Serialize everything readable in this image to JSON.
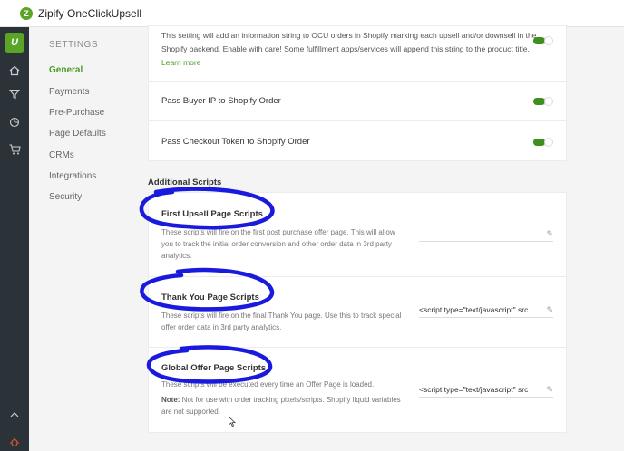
{
  "app": {
    "logo_letter": "Z",
    "title": "Zipify OneClickUpsell"
  },
  "leftbar": {
    "logo_letter": "U",
    "icons": [
      "home-icon",
      "funnel-icon",
      "chart-icon",
      "cart-icon"
    ],
    "bottom_icons": [
      "chevron-up-icon",
      "bug-icon"
    ]
  },
  "sidebar": {
    "heading": "SETTINGS",
    "items": [
      {
        "label": "General",
        "active": true
      },
      {
        "label": "Payments",
        "active": false
      },
      {
        "label": "Pre-Purchase",
        "active": false
      },
      {
        "label": "Page Defaults",
        "active": false
      },
      {
        "label": "CRMs",
        "active": false
      },
      {
        "label": "Integrations",
        "active": false
      },
      {
        "label": "Security",
        "active": false
      }
    ]
  },
  "settings": {
    "info_string_line1": "This setting will add an information string to OCU orders in Shopify marking each upsell and/or downsell in the",
    "info_string_line2": "Shopify backend. Enable with care! Some fulfillment apps/services will append this string to the product title.",
    "learn_more": "Learn more",
    "pass_buyer_ip": "Pass Buyer IP to Shopify Order",
    "pass_checkout_token": "Pass Checkout Token to Shopify Order"
  },
  "additional_scripts": {
    "title": "Additional Scripts",
    "first_upsell": {
      "title": "First Upsell Page Scripts",
      "desc_line1": "These scripts will fire on the first post purchase offer page. This will allow",
      "desc_line2": "you to track the initial order conversion and other order data in 3rd party",
      "desc_line3": "analytics.",
      "value": ""
    },
    "thank_you": {
      "title": "Thank You Page Scripts",
      "desc_line1": "These scripts will fire on the final Thank You page. Use this to track special",
      "desc_line2": "offer order data in 3rd party analytics.",
      "value": "<script type=\"text/javascript\" src"
    },
    "global_offer": {
      "title": "Global Offer Page Scripts",
      "desc_line1": "These scripts will be executed every time an Offer Page is loaded.",
      "note_label": "Note:",
      "note_line1": " Not for use with order tracking pixels/scripts. Shopify liquid variables",
      "note_line2": "are not supported.",
      "value": "<script type=\"text/javascript\" src"
    }
  },
  "colors": {
    "accent": "#4a9a22",
    "annotation": "#1a1adf",
    "leftbar": "#2c3338"
  }
}
